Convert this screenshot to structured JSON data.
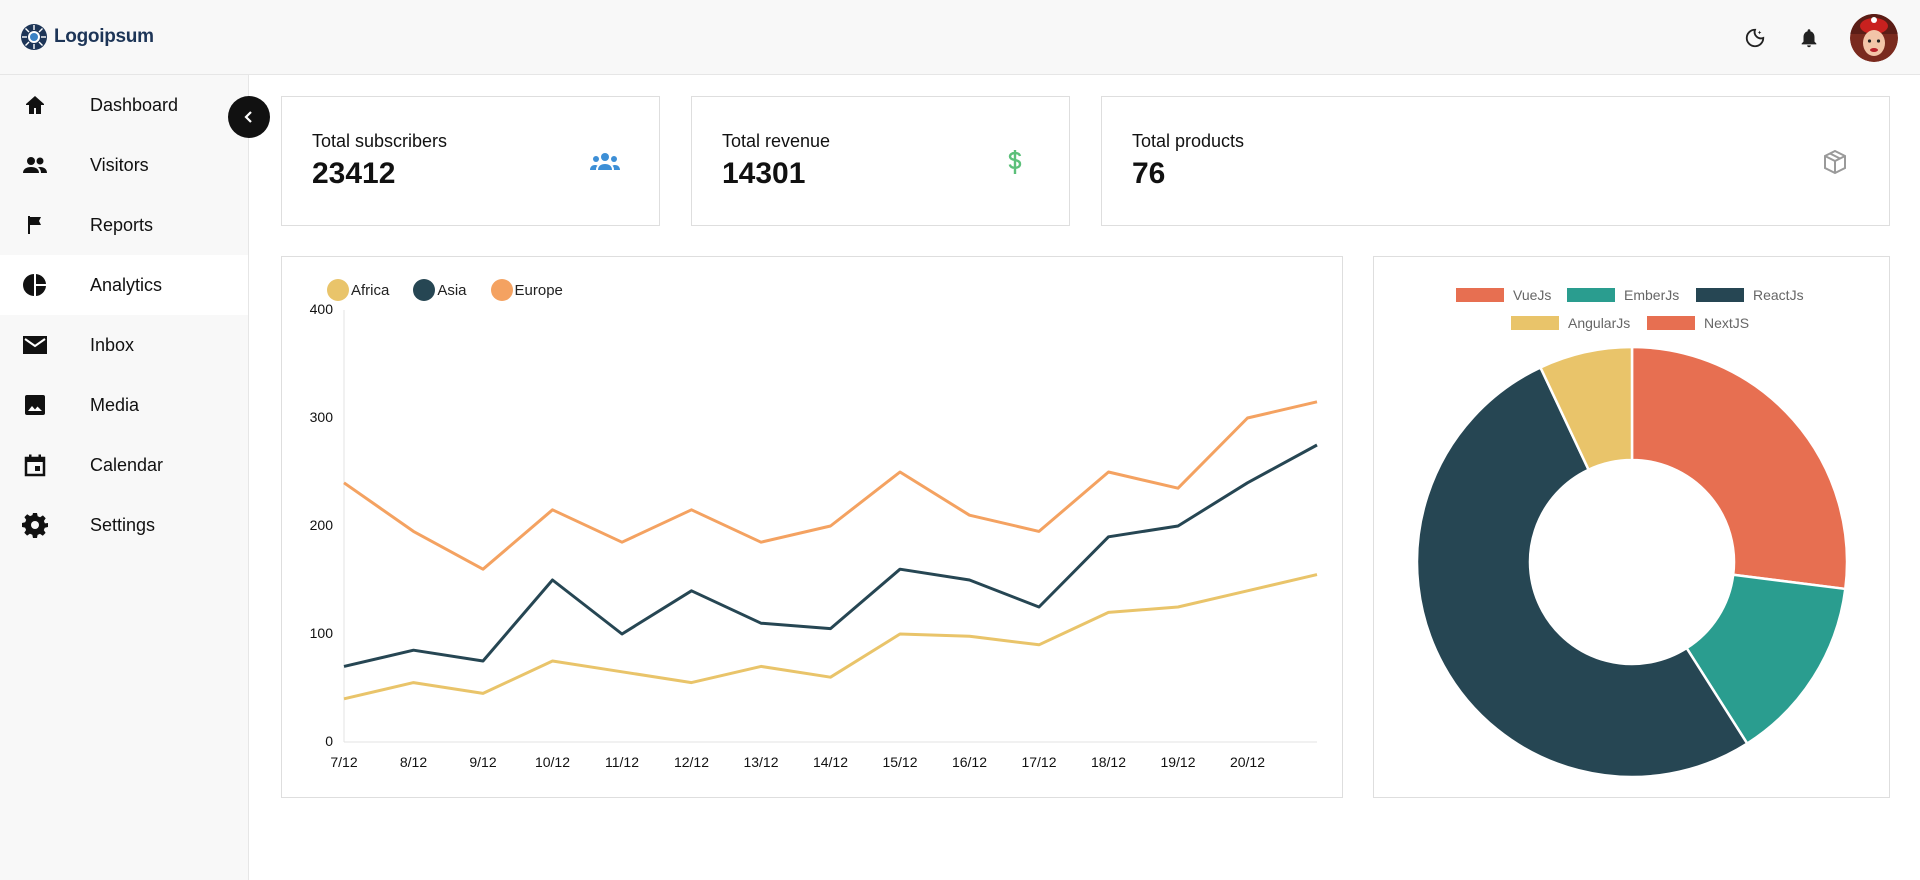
{
  "app": {
    "logo_text": "Logoipsum"
  },
  "header": {
    "icons": [
      "moon-icon",
      "bell-icon"
    ]
  },
  "sidebar": {
    "items": [
      {
        "label": "Dashboard",
        "icon": "home-icon",
        "active": false
      },
      {
        "label": "Visitors",
        "icon": "users-icon",
        "active": false
      },
      {
        "label": "Reports",
        "icon": "flag-icon",
        "active": false
      },
      {
        "label": "Analytics",
        "icon": "pie-icon",
        "active": true
      },
      {
        "label": "Inbox",
        "icon": "mail-icon",
        "active": false
      },
      {
        "label": "Media",
        "icon": "image-icon",
        "active": false
      },
      {
        "label": "Calendar",
        "icon": "calendar-icon",
        "active": false
      },
      {
        "label": "Settings",
        "icon": "gear-icon",
        "active": false
      }
    ]
  },
  "stats": [
    {
      "title": "Total subscribers",
      "value": "23412",
      "icon": "group-icon",
      "color": "#3d8fd6"
    },
    {
      "title": "Total revenue",
      "value": "14301",
      "icon": "dollar-icon",
      "color": "#5cc07a"
    },
    {
      "title": "Total products",
      "value": "76",
      "icon": "box-icon",
      "color": "#9a9a9a"
    }
  ],
  "chart_data": [
    {
      "type": "line",
      "x": [
        "7/12",
        "8/12",
        "9/12",
        "10/12",
        "11/12",
        "12/12",
        "13/12",
        "14/12",
        "15/12",
        "16/12",
        "17/12",
        "18/12",
        "19/12",
        "20/12"
      ],
      "ylim": [
        0,
        400
      ],
      "yticks": [
        0,
        100,
        200,
        300,
        400
      ],
      "grid": false,
      "legend": "top-left",
      "series": [
        {
          "name": "Africa",
          "color": "#e9c46a",
          "values": [
            40,
            55,
            45,
            75,
            65,
            55,
            70,
            60,
            100,
            98,
            90,
            120,
            125,
            140,
            155
          ]
        },
        {
          "name": "Asia",
          "color": "#264653",
          "values": [
            70,
            85,
            75,
            150,
            100,
            140,
            110,
            105,
            160,
            150,
            125,
            190,
            200,
            240,
            275
          ]
        },
        {
          "name": "Europe",
          "color": "#f4a261",
          "values": [
            240,
            195,
            160,
            215,
            185,
            215,
            185,
            200,
            250,
            210,
            195,
            250,
            235,
            300,
            315
          ]
        }
      ]
    },
    {
      "type": "pie",
      "variant": "doughnut",
      "legend": "top",
      "labels": [
        "VueJs",
        "EmberJs",
        "ReactJs",
        "AngularJs",
        "NextJS"
      ],
      "colors": [
        "#e76f51",
        "#2a9d8f",
        "#264653",
        "#e9c46a",
        "#e76f51"
      ],
      "values": [
        27,
        14,
        52,
        7,
        0
      ]
    }
  ]
}
